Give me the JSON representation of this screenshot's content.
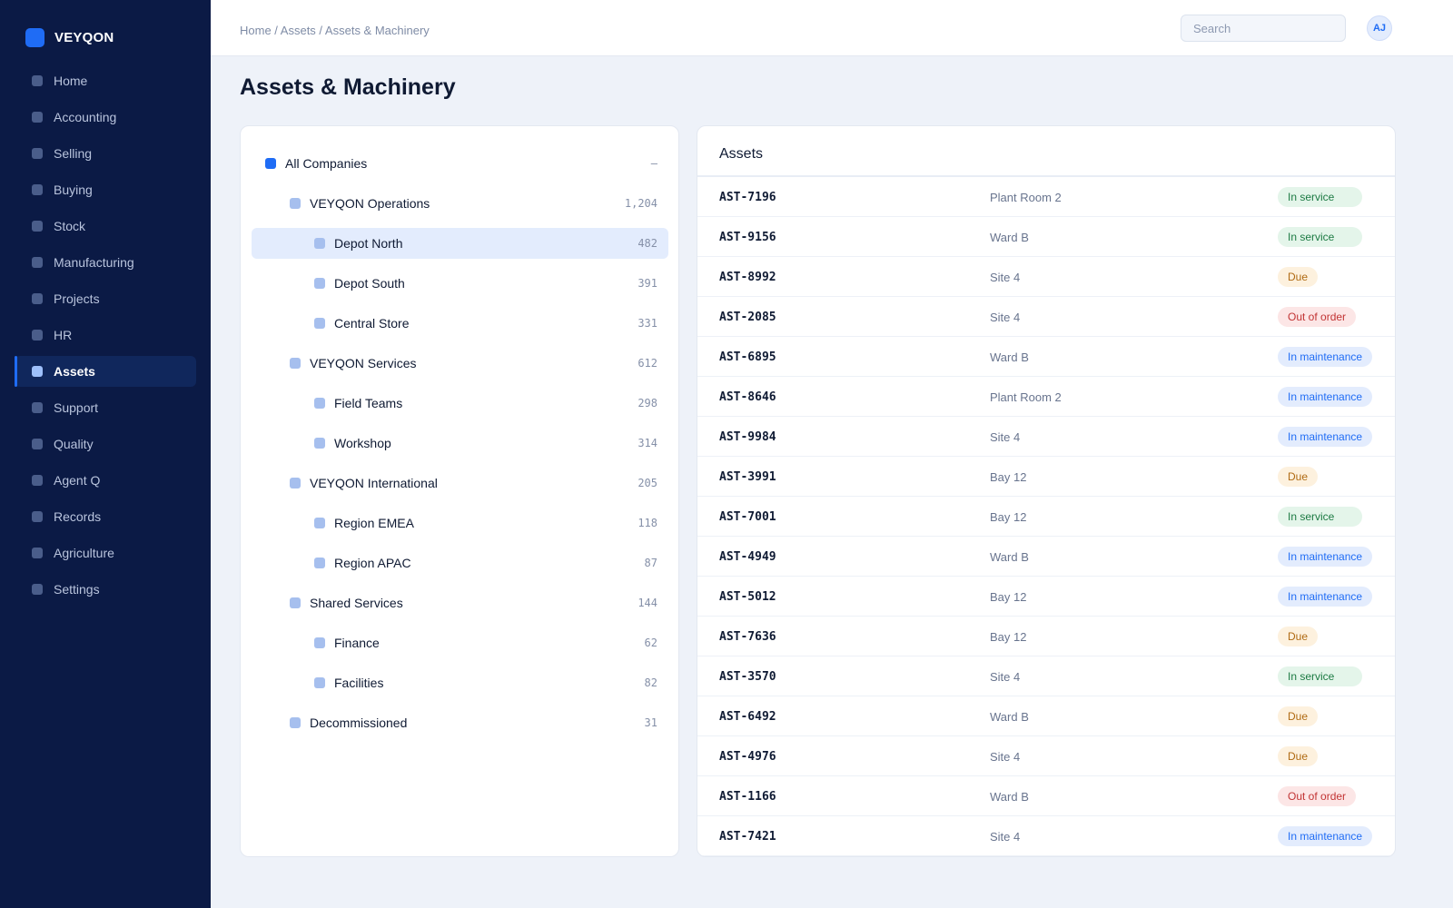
{
  "app": {
    "brand": "VEYQON"
  },
  "sidebar": {
    "items": [
      {
        "label": "Home",
        "active": false
      },
      {
        "label": "Accounting",
        "active": false
      },
      {
        "label": "Selling",
        "active": false
      },
      {
        "label": "Buying",
        "active": false
      },
      {
        "label": "Stock",
        "active": false
      },
      {
        "label": "Manufacturing",
        "active": false
      },
      {
        "label": "Projects",
        "active": false
      },
      {
        "label": "HR",
        "active": false
      },
      {
        "label": "Assets",
        "active": true
      },
      {
        "label": "Support",
        "active": false
      },
      {
        "label": "Quality",
        "active": false
      },
      {
        "label": "Agent Q",
        "active": false
      },
      {
        "label": "Records",
        "active": false
      },
      {
        "label": "Agriculture",
        "active": false
      },
      {
        "label": "Settings",
        "active": false
      }
    ]
  },
  "header": {
    "breadcrumb": "Home / Assets / Assets & Machinery",
    "search_placeholder": "Search",
    "search_value": "",
    "avatar_initials": "AJ"
  },
  "page": {
    "title": "Assets & Machinery"
  },
  "tree": {
    "items": [
      {
        "label": "All Companies",
        "count": "–",
        "level": 0
      },
      {
        "label": "VEYQON Operations",
        "count": "1,204",
        "level": 1
      },
      {
        "label": "Depot North",
        "count": "482",
        "level": 2,
        "selected": true
      },
      {
        "label": "Depot South",
        "count": "391",
        "level": 2
      },
      {
        "label": "Central Store",
        "count": "331",
        "level": 2
      },
      {
        "label": "VEYQON Services",
        "count": "612",
        "level": 1
      },
      {
        "label": "Field Teams",
        "count": "298",
        "level": 2
      },
      {
        "label": "Workshop",
        "count": "314",
        "level": 2
      },
      {
        "label": "VEYQON International",
        "count": "205",
        "level": 1
      },
      {
        "label": "Region EMEA",
        "count": "118",
        "level": 2
      },
      {
        "label": "Region APAC",
        "count": "87",
        "level": 2
      },
      {
        "label": "Shared Services",
        "count": "144",
        "level": 1
      },
      {
        "label": "Finance",
        "count": "62",
        "level": 2
      },
      {
        "label": "Facilities",
        "count": "82",
        "level": 2
      },
      {
        "label": "Decommissioned",
        "count": "31",
        "level": 1
      }
    ]
  },
  "assets": {
    "title": "Assets",
    "rows": [
      {
        "id": "AST-7196",
        "location": "Plant Room 2",
        "status": "In service"
      },
      {
        "id": "AST-9156",
        "location": "Ward B",
        "status": "In service"
      },
      {
        "id": "AST-8992",
        "location": "Site 4",
        "status": "Due"
      },
      {
        "id": "AST-2085",
        "location": "Site 4",
        "status": "Out of order"
      },
      {
        "id": "AST-6895",
        "location": "Ward B",
        "status": "In maintenance"
      },
      {
        "id": "AST-8646",
        "location": "Plant Room 2",
        "status": "In maintenance"
      },
      {
        "id": "AST-9984",
        "location": "Site 4",
        "status": "In maintenance"
      },
      {
        "id": "AST-3991",
        "location": "Bay 12",
        "status": "Due"
      },
      {
        "id": "AST-7001",
        "location": "Bay 12",
        "status": "In service"
      },
      {
        "id": "AST-4949",
        "location": "Ward B",
        "status": "In maintenance"
      },
      {
        "id": "AST-5012",
        "location": "Bay 12",
        "status": "In maintenance"
      },
      {
        "id": "AST-7636",
        "location": "Bay 12",
        "status": "Due"
      },
      {
        "id": "AST-3570",
        "location": "Site 4",
        "status": "In service"
      },
      {
        "id": "AST-6492",
        "location": "Ward B",
        "status": "Due"
      },
      {
        "id": "AST-4976",
        "location": "Site 4",
        "status": "Due"
      },
      {
        "id": "AST-1166",
        "location": "Ward B",
        "status": "Out of order"
      },
      {
        "id": "AST-7421",
        "location": "Site 4",
        "status": "In maintenance"
      }
    ]
  },
  "colors": {
    "sidebar_bg": "#0b1a45",
    "accent": "#1f6cf5",
    "page_bg": "#eef2f9",
    "status_in_service": "#1c7a43",
    "status_due": "#b06a12",
    "status_out_of_order": "#c23434",
    "status_in_maintenance": "#1f6cf5"
  }
}
